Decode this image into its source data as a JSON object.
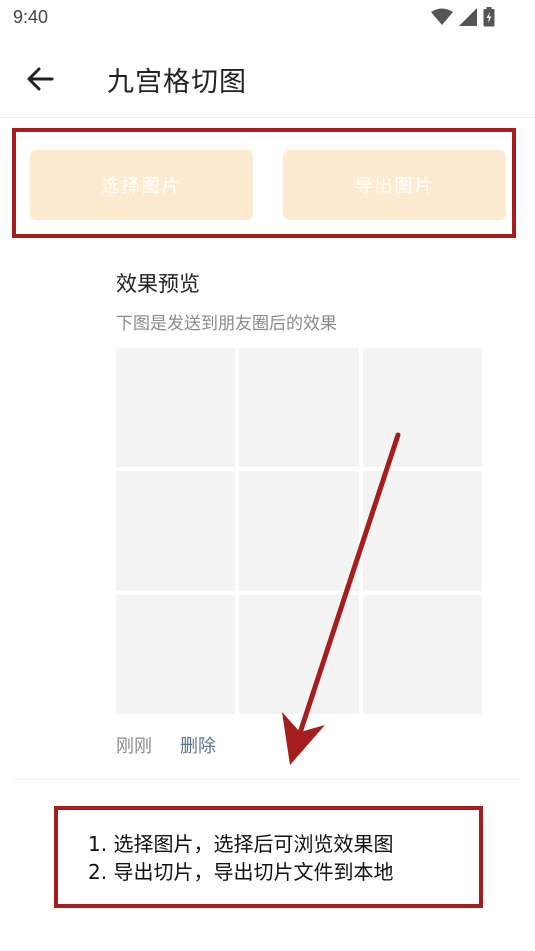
{
  "status_bar": {
    "time": "9:40",
    "icons": [
      "wifi-icon",
      "signal-icon",
      "battery-icon"
    ]
  },
  "app_bar": {
    "back_icon": "arrow-left-icon",
    "title": "九宫格切图"
  },
  "actions": {
    "select_label": "选择图片",
    "export_label": "导出图片"
  },
  "preview": {
    "title": "效果预览",
    "subtitle": "下图是发送到朋友圈后的效果",
    "cell_count": 9
  },
  "post_meta": {
    "time_label": "刚刚",
    "delete_label": "删除"
  },
  "annotation": {
    "line1": "1. 选择图片，选择后可浏览效果图",
    "line2": "2. 导出切片，导出切片文件到本地"
  },
  "colors": {
    "button_bg": "#fcebd1",
    "annotation_red": "#a51e1e",
    "link_color": "#5c7690"
  }
}
